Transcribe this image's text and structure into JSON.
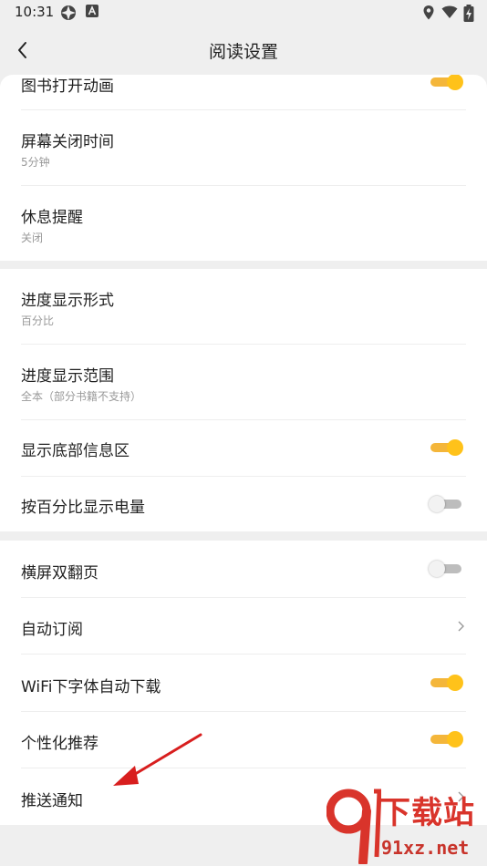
{
  "status_bar": {
    "time": "10:31"
  },
  "header": {
    "title": "阅读设置"
  },
  "section1": {
    "book_open_animation": {
      "label": "图书打开动画",
      "enabled": true
    },
    "screen_off_time": {
      "label": "屏幕关闭时间",
      "value": "5分钟"
    },
    "rest_reminder": {
      "label": "休息提醒",
      "value": "关闭"
    }
  },
  "section2": {
    "progress_display_format": {
      "label": "进度显示形式",
      "value": "百分比"
    },
    "progress_display_range": {
      "label": "进度显示范围",
      "value": "全本（部分书籍不支持）"
    },
    "show_bottom_info": {
      "label": "显示底部信息区",
      "enabled": true
    },
    "battery_percentage": {
      "label": "按百分比显示电量",
      "enabled": false
    }
  },
  "section3": {
    "landscape_double_page": {
      "label": "横屏双翻页",
      "enabled": false
    },
    "auto_subscribe": {
      "label": "自动订阅"
    },
    "wifi_font_download": {
      "label": "WiFi下字体自动下载",
      "enabled": true
    },
    "personalized_recommend": {
      "label": "个性化推荐",
      "enabled": true
    },
    "push_notification": {
      "label": "推送通知"
    }
  },
  "watermark": {
    "brand": "下载站",
    "domain": "91xz.net"
  },
  "colors": {
    "accent": "#ffc21a",
    "background": "#efefef",
    "annotation_arrow": "#d81e1e"
  }
}
